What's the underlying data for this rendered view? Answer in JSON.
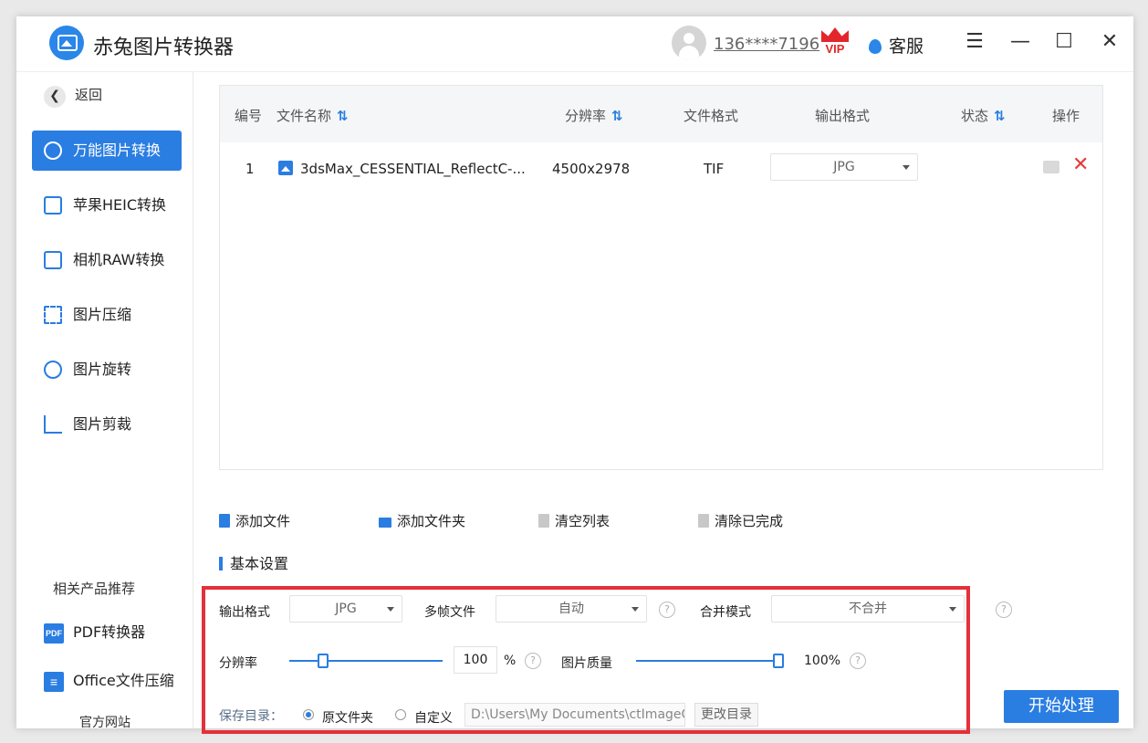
{
  "app": {
    "title": "赤兔图片转换器",
    "user_phone": "136****7196",
    "vip_label": "VIP",
    "service_label": "客服"
  },
  "window_controls": {
    "menu": "☰",
    "minimize": "—",
    "maximize": "☐",
    "close": "✕"
  },
  "sidebar": {
    "back_label": "返回",
    "items": [
      {
        "label": "万能图片转换",
        "icon": "image-convert-icon",
        "active": true
      },
      {
        "label": "苹果HEIC转换",
        "icon": "heic-icon",
        "active": false
      },
      {
        "label": "相机RAW转换",
        "icon": "raw-icon",
        "active": false
      },
      {
        "label": "图片压缩",
        "icon": "compress-icon",
        "active": false
      },
      {
        "label": "图片旋转",
        "icon": "rotate-icon",
        "active": false
      },
      {
        "label": "图片剪裁",
        "icon": "crop-icon",
        "active": false
      }
    ],
    "related_title": "相关产品推荐",
    "products": [
      {
        "label": "PDF转换器",
        "icon_text": "PDF"
      },
      {
        "label": "Office文件压缩",
        "icon_text": "≡"
      }
    ],
    "official_site": "官方网站"
  },
  "table": {
    "headers": {
      "index": "编号",
      "filename": "文件名称",
      "resolution": "分辨率",
      "format": "文件格式",
      "output": "输出格式",
      "status": "状态",
      "actions": "操作"
    },
    "sort_glyph": "⇅",
    "rows": [
      {
        "index": "1",
        "filename": "3dsMax_CESSENTIAL_ReflectC-...",
        "resolution": "4500x2978",
        "format": "TIF",
        "output": "JPG",
        "status": ""
      }
    ]
  },
  "toolbar": {
    "add_file": "添加文件",
    "add_folder": "添加文件夹",
    "clear_list": "清空列表",
    "clear_done": "清除已完成"
  },
  "settings": {
    "title": "基本设置",
    "output_format_label": "输出格式",
    "output_format_value": "JPG",
    "multiframe_label": "多帧文件",
    "multiframe_value": "自动",
    "merge_label": "合并模式",
    "merge_value": "不合并",
    "resolution_label": "分辨率",
    "resolution_value": "100",
    "resolution_unit": "%",
    "resolution_slider_fraction": 0.2,
    "quality_label": "图片质量",
    "quality_value": "100%",
    "quality_slider_fraction": 1.0,
    "save_dir_label": "保存目录：",
    "radio_original": "原文件夹",
    "radio_custom": "自定义",
    "selected_radio": "original",
    "path_value": "D:\\Users\\My Documents\\ctImageC",
    "change_dir_label": "更改目录",
    "help_glyph": "?"
  },
  "start_label": "开始处理",
  "colors": {
    "accent": "#2a7de1",
    "highlight_border": "#e5303a",
    "delete": "#e83a3a",
    "vip": "#e2262b"
  }
}
